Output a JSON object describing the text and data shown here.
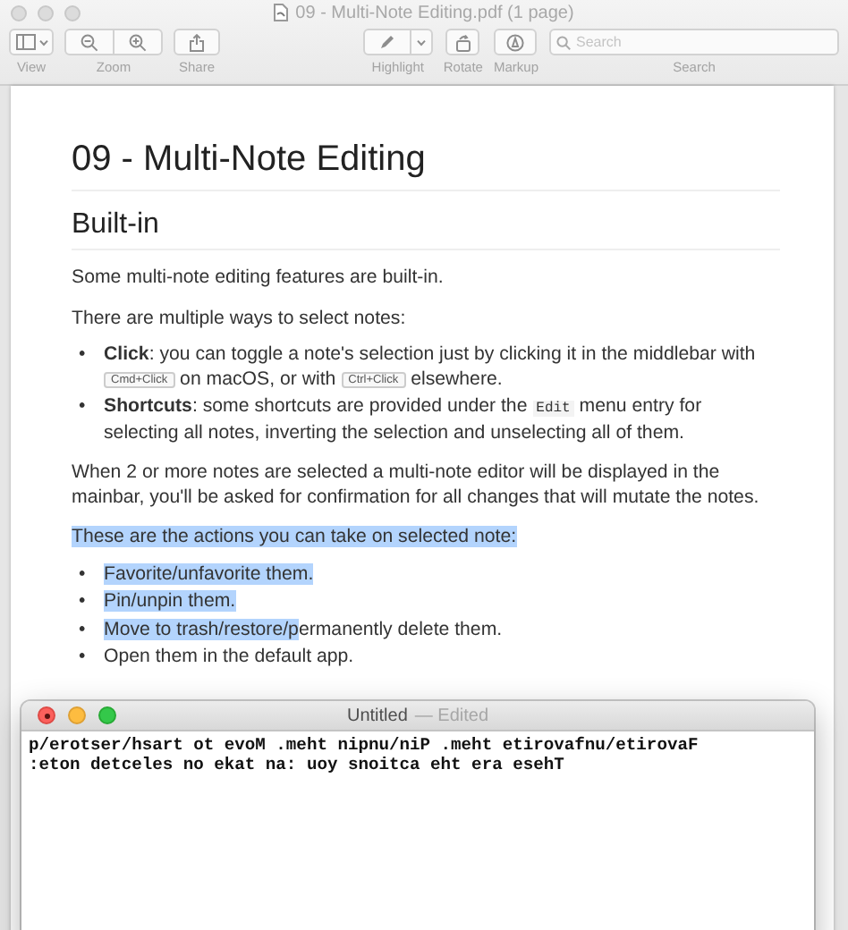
{
  "window": {
    "title": "09 - Multi-Note Editing.pdf (1 page)",
    "focused": false
  },
  "toolbar": {
    "items": [
      {
        "kind": "view",
        "label": "View"
      },
      {
        "kind": "zoom",
        "label": "Zoom"
      },
      {
        "kind": "share",
        "label": "Share"
      },
      {
        "kind": "highlight",
        "label": "Highlight"
      },
      {
        "kind": "rotate",
        "label": "Rotate"
      },
      {
        "kind": "markup",
        "label": "Markup"
      },
      {
        "kind": "search",
        "label": "Search",
        "placeholder": "Search"
      }
    ]
  },
  "document": {
    "title": "09 - Multi-Note Editing",
    "sections": [
      {
        "heading": "Built-in",
        "blocks": [
          {
            "kind": "paragraph",
            "segments": [
              {
                "text": "Some multi-note editing features are built-in.",
                "kind": "plain",
                "selected": false
              }
            ]
          },
          {
            "kind": "paragraph",
            "segments": [
              {
                "text": "There are multiple ways to select notes:",
                "kind": "plain",
                "selected": false
              }
            ]
          },
          {
            "kind": "list",
            "items": [
              {
                "marker": "•",
                "segments": [
                  {
                    "text": "Click",
                    "kind": "bold",
                    "selected": false
                  },
                  {
                    "text": ": you can toggle a note's selection just by clicking it in the middlebar with ",
                    "kind": "plain",
                    "selected": false
                  },
                  {
                    "text": "Cmd+Click",
                    "kind": "key",
                    "selected": false
                  },
                  {
                    "text": " on macOS, or with ",
                    "kind": "plain",
                    "selected": false
                  },
                  {
                    "text": "Ctrl+Click",
                    "kind": "key",
                    "selected": false
                  },
                  {
                    "text": " elsewhere.",
                    "kind": "plain",
                    "selected": false
                  }
                ]
              },
              {
                "marker": "•",
                "segments": [
                  {
                    "text": "Shortcuts",
                    "kind": "bold",
                    "selected": false
                  },
                  {
                    "text": ": some shortcuts are provided under the ",
                    "kind": "plain",
                    "selected": false
                  },
                  {
                    "text": "Edit",
                    "kind": "code",
                    "selected": false
                  },
                  {
                    "text": " menu entry for selecting all notes, inverting the selection and unselecting all of them.",
                    "kind": "plain",
                    "selected": false
                  }
                ]
              }
            ]
          },
          {
            "kind": "paragraph",
            "segments": [
              {
                "text": "When 2 or more notes are selected a multi-note editor will be displayed in the mainbar, you'll be asked for confirmation for all changes that will mutate the notes.",
                "kind": "plain",
                "selected": false
              }
            ]
          },
          {
            "kind": "paragraph",
            "segments": [
              {
                "text": "These are the actions you can take on selected note:",
                "kind": "plain",
                "selected": true
              }
            ]
          },
          {
            "kind": "list",
            "items": [
              {
                "marker": "•",
                "segments": [
                  {
                    "text": "Favorite/unfavorite them.",
                    "kind": "plain",
                    "selected": true
                  }
                ]
              },
              {
                "marker": "•",
                "segments": [
                  {
                    "text": "Pin/unpin them.",
                    "kind": "plain",
                    "selected": true
                  }
                ]
              },
              {
                "marker": "•",
                "segments": [
                  {
                    "text": "Move to trash/restore/p",
                    "kind": "plain",
                    "selected": true
                  },
                  {
                    "text": "ermanently delete them.",
                    "kind": "plain",
                    "selected": false
                  }
                ]
              },
              {
                "marker": "•",
                "segments": [
                  {
                    "text": "Open them in the default app.",
                    "kind": "plain",
                    "selected": false
                  }
                ]
              }
            ]
          }
        ]
      }
    ]
  },
  "editor": {
    "title": "Untitled",
    "status": "— Edited",
    "focused": true,
    "edited": true,
    "lines": [
      "p/erotser/hsart ot evoM .meht nipnu/niP .meht etirovafnu/etirovaF",
      ":eton detceles no ekat na: uoy snoitca eht era esehT"
    ]
  }
}
